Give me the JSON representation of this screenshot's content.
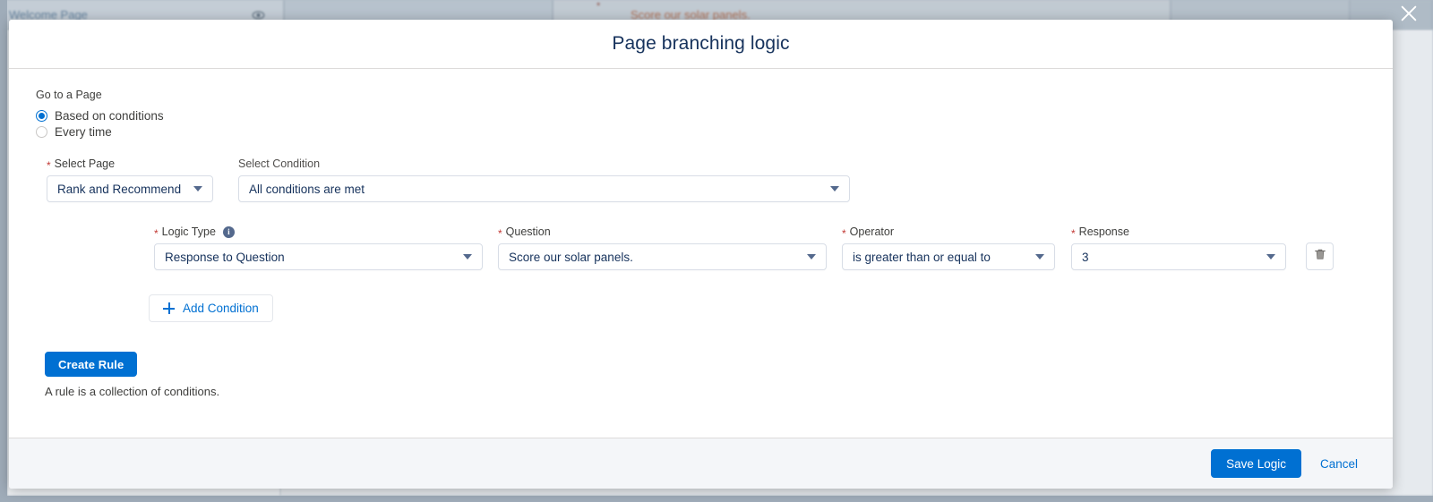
{
  "background": {
    "welcome_page_label": "Welcome Page",
    "question_label": "Score our solar panels.",
    "eye_icon": "eye-icon",
    "required_asterisk": "*"
  },
  "close_button": {
    "icon": "close-icon",
    "label": "Close"
  },
  "modal": {
    "title": "Page branching logic",
    "go_to_page": {
      "label": "Go to a Page",
      "options": [
        {
          "label": "Based on conditions",
          "selected": true
        },
        {
          "label": "Every time",
          "selected": false
        }
      ]
    },
    "select_page": {
      "label": "Select Page",
      "required": true,
      "value": "Rank and Recommend"
    },
    "select_condition": {
      "label": "Select Condition",
      "required": false,
      "value": "All conditions are met"
    },
    "condition_row": {
      "logic_type": {
        "label": "Logic Type",
        "required": true,
        "info_icon": "info-icon",
        "value": "Response to Question"
      },
      "question": {
        "label": "Question",
        "required": true,
        "value": "Score our solar panels."
      },
      "operator": {
        "label": "Operator",
        "required": true,
        "value": "is greater than or equal to"
      },
      "response": {
        "label": "Response",
        "required": true,
        "value": "3"
      },
      "delete_icon": "trash-icon"
    },
    "add_condition": {
      "label": "Add Condition",
      "icon": "plus-icon"
    },
    "create_rule": {
      "label": "Create Rule",
      "helper_text": "A rule is a collection of conditions."
    },
    "footer": {
      "save_label": "Save Logic",
      "cancel_label": "Cancel"
    }
  },
  "colors": {
    "accent_blue": "#0070d2",
    "required_red": "#c23934",
    "title_navy": "#16325c",
    "footer_gray": "#f4f6f9"
  }
}
